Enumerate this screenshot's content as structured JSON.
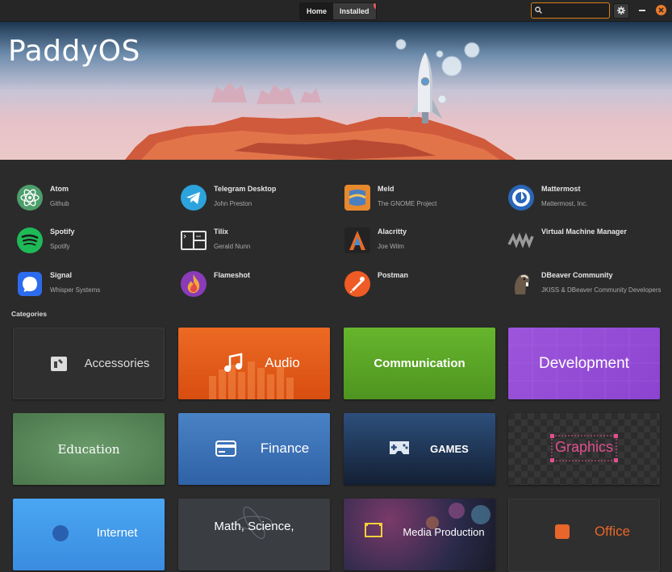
{
  "header": {
    "tabs": [
      {
        "label": "Home",
        "active": true
      },
      {
        "label": "Installed",
        "badge": "4"
      }
    ],
    "search": {
      "value": "",
      "placeholder": ""
    },
    "settings_icon": "gear-icon",
    "window_controls": [
      "minimize-icon",
      "close-icon"
    ]
  },
  "banner": {
    "title": "PaddyOS"
  },
  "featured_apps": [
    {
      "name": "Atom",
      "developer": "Github",
      "icon": "atom-icon"
    },
    {
      "name": "Telegram Desktop",
      "developer": "John Preston",
      "icon": "telegram-icon"
    },
    {
      "name": "Meld",
      "developer": "The GNOME Project",
      "icon": "meld-icon"
    },
    {
      "name": "Mattermost",
      "developer": "Mattermost, Inc.",
      "icon": "mattermost-icon"
    },
    {
      "name": "Spotify",
      "developer": "Spotify",
      "icon": "spotify-icon"
    },
    {
      "name": "Tilix",
      "developer": "Gerald Nunn",
      "icon": "tilix-icon"
    },
    {
      "name": "Alacritty",
      "developer": "Joe Wilm",
      "icon": "alacritty-icon"
    },
    {
      "name": "Virtual Machine Manager",
      "developer": "",
      "icon": "virt-manager-icon"
    },
    {
      "name": "Signal",
      "developer": "Whisper Systems",
      "icon": "signal-icon"
    },
    {
      "name": "Flameshot",
      "developer": "",
      "icon": "flameshot-icon"
    },
    {
      "name": "Postman",
      "developer": "",
      "icon": "postman-icon"
    },
    {
      "name": "DBeaver Community",
      "developer": "JKISS & DBeaver Community Developers",
      "icon": "dbeaver-icon"
    }
  ],
  "categories_heading": "Categories",
  "categories": [
    {
      "label": "Accessories",
      "icon": "accessories-icon"
    },
    {
      "label": "Audio",
      "icon": "music-note-icon"
    },
    {
      "label": "Communication",
      "icon": ""
    },
    {
      "label": "Development",
      "icon": ""
    },
    {
      "label": "Education",
      "icon": ""
    },
    {
      "label": "Finance",
      "icon": "credit-card-icon"
    },
    {
      "label": "GAMES",
      "icon": "gamepad-icon"
    },
    {
      "label": "Graphics",
      "icon": ""
    },
    {
      "label": "Internet",
      "icon": "globe-icon"
    },
    {
      "label": "Math, Science,",
      "icon": ""
    },
    {
      "label": "Media Production",
      "icon": "film-icon"
    },
    {
      "label": "Office",
      "icon": "office-icon"
    }
  ],
  "colors": {
    "accent": "#e87b2b",
    "background": "#2b2b2b",
    "audio": "#e8571c",
    "communication": "#58a62b",
    "development": "#9b54d8",
    "education": "#5b8a5b",
    "finance": "#3e72b6",
    "games": "#1f3a5e",
    "graphics": "#e0508e"
  }
}
